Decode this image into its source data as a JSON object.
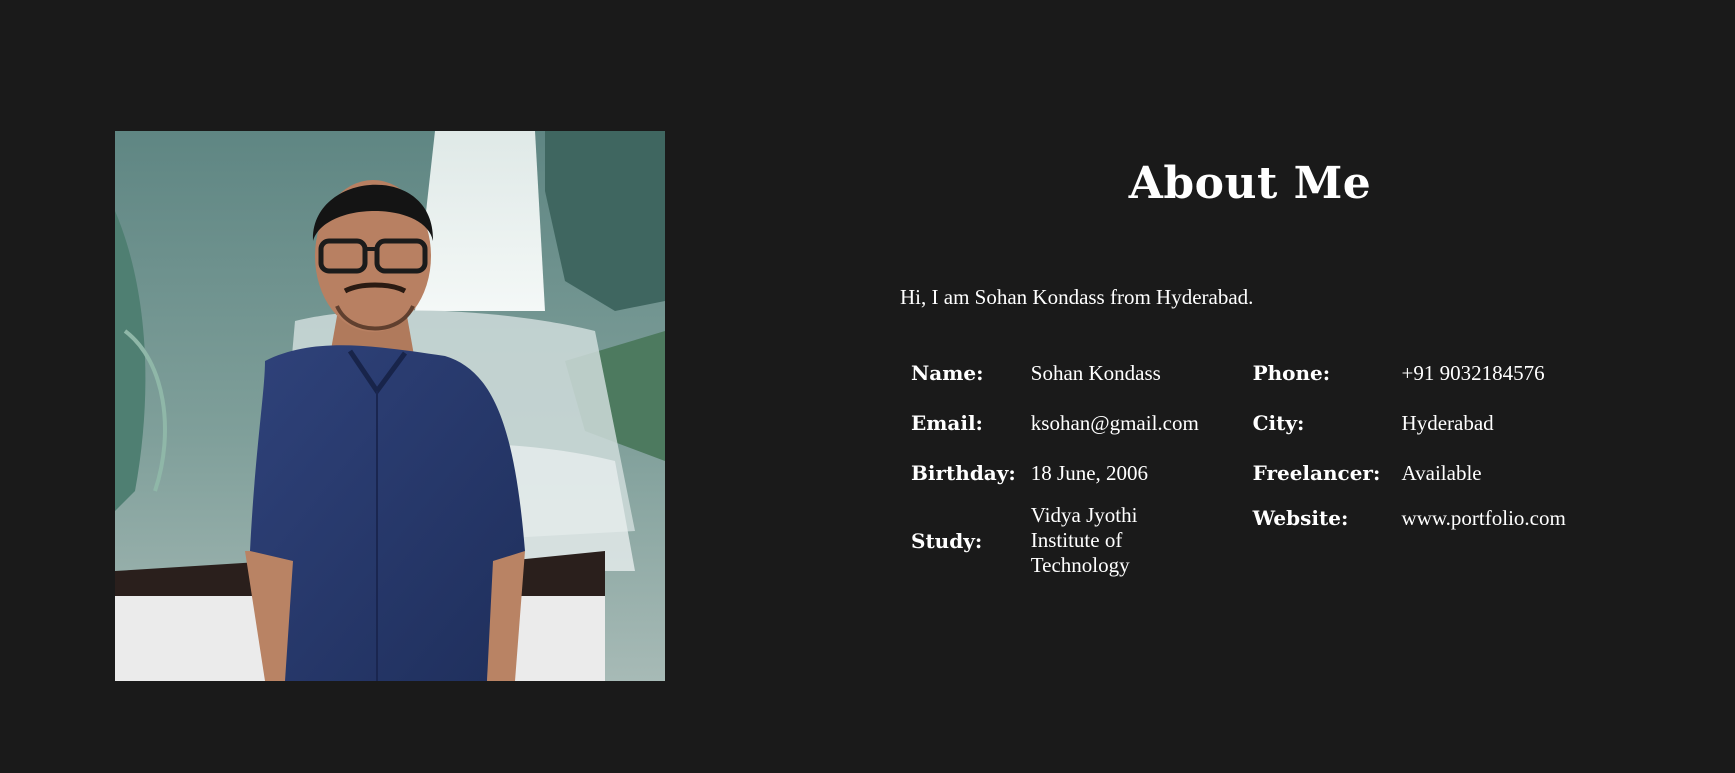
{
  "about": {
    "title": "About Me",
    "intro": "Hi, I am Sohan Kondass from Hyderabad."
  },
  "photo": {
    "alt": "Portrait photo"
  },
  "info": {
    "name_label": "Name:",
    "name_value": "Sohan Kondass",
    "phone_label": "Phone:",
    "phone_value": "+91 9032184576",
    "email_label": "Email:",
    "email_value": "ksohan@gmail.com",
    "city_label": "City:",
    "city_value": "Hyderabad",
    "birthday_label": "Birthday:",
    "birthday_value": "18 June, 2006",
    "freelancer_label": "Freelancer:",
    "freelancer_value": "Available",
    "study_label": "Study:",
    "study_value": "Vidya Jyothi Institute of Technology",
    "website_label": "Website:",
    "website_value": "www.portfolio.com"
  },
  "colors": {
    "background": "#1a1a1a",
    "text": "#ffffff"
  }
}
